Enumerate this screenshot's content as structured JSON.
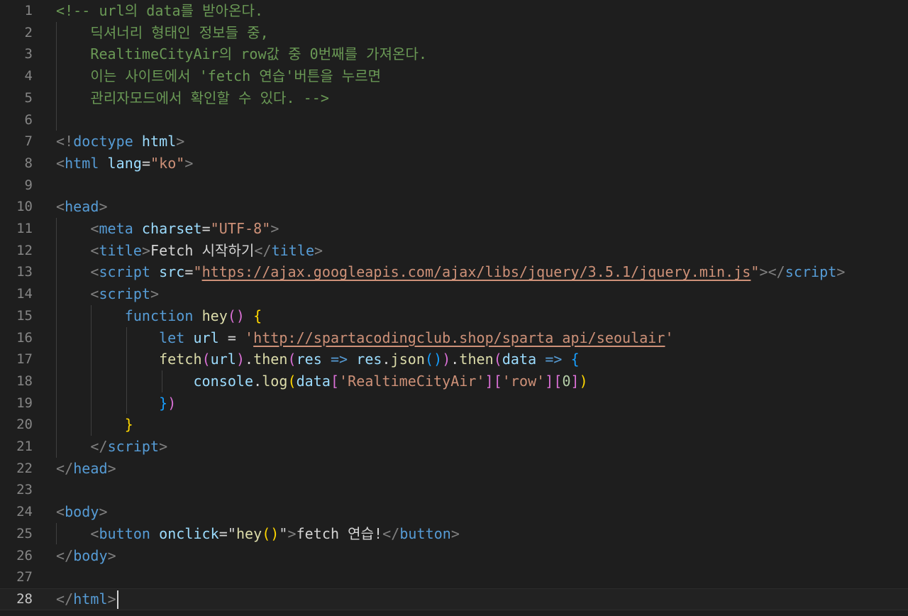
{
  "editor": {
    "language": "html",
    "current_line": 28,
    "colors": {
      "background": "#1e1e1e",
      "comment": "#6a9955",
      "tag": "#569cd6",
      "attribute": "#9cdcfe",
      "string": "#ce9178",
      "function": "#dcdcaa",
      "bracket_level1": "#ffd700",
      "bracket_level2": "#da70d6",
      "bracket_level3": "#179fff"
    },
    "lines": [
      {
        "n": "1",
        "tokens": [
          {
            "t": "<!-- url의 data를 받아온다.",
            "c": "cmt"
          }
        ]
      },
      {
        "n": "2",
        "tokens": [
          {
            "t": "    딕셔너리 형태인 정보들 중,",
            "c": "cmt"
          }
        ]
      },
      {
        "n": "3",
        "tokens": [
          {
            "t": "    RealtimeCityAir의 row값 중 0번째를 가져온다.",
            "c": "cmt"
          }
        ]
      },
      {
        "n": "4",
        "tokens": [
          {
            "t": "    이는 사이트에서 'fetch 연습'버튼을 누르면",
            "c": "cmt"
          }
        ]
      },
      {
        "n": "5",
        "tokens": [
          {
            "t": "    관리자모드에서 확인할 수 있다. -->",
            "c": "cmt"
          }
        ]
      },
      {
        "n": "6",
        "tokens": []
      },
      {
        "n": "7",
        "tokens": [
          {
            "t": "<!",
            "c": "pun"
          },
          {
            "t": "doctype",
            "c": "tag"
          },
          {
            "t": " html",
            "c": "attr"
          },
          {
            "t": ">",
            "c": "pun"
          }
        ]
      },
      {
        "n": "8",
        "tokens": [
          {
            "t": "<",
            "c": "pun"
          },
          {
            "t": "html",
            "c": "tag"
          },
          {
            "t": " lang",
            "c": "attr"
          },
          {
            "t": "=",
            "c": "op"
          },
          {
            "t": "\"ko\"",
            "c": "str"
          },
          {
            "t": ">",
            "c": "pun"
          }
        ]
      },
      {
        "n": "9",
        "tokens": []
      },
      {
        "n": "10",
        "tokens": [
          {
            "t": "<",
            "c": "pun"
          },
          {
            "t": "head",
            "c": "tag"
          },
          {
            "t": ">",
            "c": "pun"
          }
        ]
      },
      {
        "n": "11",
        "tokens": [
          {
            "t": "    ",
            "c": "txt"
          },
          {
            "t": "<",
            "c": "pun"
          },
          {
            "t": "meta",
            "c": "tag"
          },
          {
            "t": " charset",
            "c": "attr"
          },
          {
            "t": "=",
            "c": "op"
          },
          {
            "t": "\"UTF-8\"",
            "c": "str"
          },
          {
            "t": ">",
            "c": "pun"
          }
        ]
      },
      {
        "n": "12",
        "tokens": [
          {
            "t": "    ",
            "c": "txt"
          },
          {
            "t": "<",
            "c": "pun"
          },
          {
            "t": "title",
            "c": "tag"
          },
          {
            "t": ">",
            "c": "pun"
          },
          {
            "t": "Fetch 시작하기",
            "c": "txt"
          },
          {
            "t": "</",
            "c": "pun"
          },
          {
            "t": "title",
            "c": "tag"
          },
          {
            "t": ">",
            "c": "pun"
          }
        ]
      },
      {
        "n": "13",
        "tokens": [
          {
            "t": "    ",
            "c": "txt"
          },
          {
            "t": "<",
            "c": "pun"
          },
          {
            "t": "script",
            "c": "tag"
          },
          {
            "t": " src",
            "c": "attr"
          },
          {
            "t": "=",
            "c": "op"
          },
          {
            "t": "\"",
            "c": "str"
          },
          {
            "t": "https://ajax.googleapis.com/ajax/libs/jquery/3.5.1/jquery.min.js",
            "c": "str ul"
          },
          {
            "t": "\"",
            "c": "str"
          },
          {
            "t": "></",
            "c": "pun"
          },
          {
            "t": "script",
            "c": "tag"
          },
          {
            "t": ">",
            "c": "pun"
          }
        ]
      },
      {
        "n": "14",
        "tokens": [
          {
            "t": "    ",
            "c": "txt"
          },
          {
            "t": "<",
            "c": "pun"
          },
          {
            "t": "script",
            "c": "tag"
          },
          {
            "t": ">",
            "c": "pun"
          }
        ]
      },
      {
        "n": "15",
        "tokens": [
          {
            "t": "        ",
            "c": "txt"
          },
          {
            "t": "function",
            "c": "kw"
          },
          {
            "t": " ",
            "c": "txt"
          },
          {
            "t": "hey",
            "c": "fn"
          },
          {
            "t": "()",
            "c": "b2"
          },
          {
            "t": " ",
            "c": "txt"
          },
          {
            "t": "{",
            "c": "b1"
          }
        ]
      },
      {
        "n": "16",
        "tokens": [
          {
            "t": "            ",
            "c": "txt"
          },
          {
            "t": "let",
            "c": "kw"
          },
          {
            "t": " ",
            "c": "txt"
          },
          {
            "t": "url",
            "c": "var"
          },
          {
            "t": " = ",
            "c": "op"
          },
          {
            "t": "'",
            "c": "str"
          },
          {
            "t": "http://spartacodingclub.shop/sparta_api/seoulair",
            "c": "str ul"
          },
          {
            "t": "'",
            "c": "str"
          }
        ]
      },
      {
        "n": "17",
        "tokens": [
          {
            "t": "            ",
            "c": "txt"
          },
          {
            "t": "fetch",
            "c": "fn"
          },
          {
            "t": "(",
            "c": "b2"
          },
          {
            "t": "url",
            "c": "var"
          },
          {
            "t": ")",
            "c": "b2"
          },
          {
            "t": ".",
            "c": "op"
          },
          {
            "t": "then",
            "c": "fn"
          },
          {
            "t": "(",
            "c": "b2"
          },
          {
            "t": "res",
            "c": "var"
          },
          {
            "t": " ",
            "c": "txt"
          },
          {
            "t": "=>",
            "c": "kw"
          },
          {
            "t": " ",
            "c": "txt"
          },
          {
            "t": "res",
            "c": "var"
          },
          {
            "t": ".",
            "c": "op"
          },
          {
            "t": "json",
            "c": "fn"
          },
          {
            "t": "()",
            "c": "b3"
          },
          {
            "t": ")",
            "c": "b2"
          },
          {
            "t": ".",
            "c": "op"
          },
          {
            "t": "then",
            "c": "fn"
          },
          {
            "t": "(",
            "c": "b2"
          },
          {
            "t": "data",
            "c": "var"
          },
          {
            "t": " ",
            "c": "txt"
          },
          {
            "t": "=>",
            "c": "kw"
          },
          {
            "t": " ",
            "c": "txt"
          },
          {
            "t": "{",
            "c": "b3"
          }
        ]
      },
      {
        "n": "18",
        "tokens": [
          {
            "t": "                ",
            "c": "txt"
          },
          {
            "t": "console",
            "c": "var"
          },
          {
            "t": ".",
            "c": "op"
          },
          {
            "t": "log",
            "c": "fn"
          },
          {
            "t": "(",
            "c": "b1"
          },
          {
            "t": "data",
            "c": "var"
          },
          {
            "t": "[",
            "c": "b2"
          },
          {
            "t": "'RealtimeCityAir'",
            "c": "str"
          },
          {
            "t": "]",
            "c": "b2"
          },
          {
            "t": "[",
            "c": "b2"
          },
          {
            "t": "'row'",
            "c": "str"
          },
          {
            "t": "]",
            "c": "b2"
          },
          {
            "t": "[",
            "c": "b2"
          },
          {
            "t": "0",
            "c": "num"
          },
          {
            "t": "]",
            "c": "b2"
          },
          {
            "t": ")",
            "c": "b1"
          }
        ]
      },
      {
        "n": "19",
        "tokens": [
          {
            "t": "            ",
            "c": "txt"
          },
          {
            "t": "}",
            "c": "b3"
          },
          {
            "t": ")",
            "c": "b2"
          }
        ]
      },
      {
        "n": "20",
        "tokens": [
          {
            "t": "        ",
            "c": "txt"
          },
          {
            "t": "}",
            "c": "b1"
          }
        ]
      },
      {
        "n": "21",
        "tokens": [
          {
            "t": "    ",
            "c": "txt"
          },
          {
            "t": "</",
            "c": "pun"
          },
          {
            "t": "script",
            "c": "tag"
          },
          {
            "t": ">",
            "c": "pun"
          }
        ]
      },
      {
        "n": "22",
        "tokens": [
          {
            "t": "</",
            "c": "pun"
          },
          {
            "t": "head",
            "c": "tag"
          },
          {
            "t": ">",
            "c": "pun"
          }
        ]
      },
      {
        "n": "23",
        "tokens": []
      },
      {
        "n": "24",
        "tokens": [
          {
            "t": "<",
            "c": "pun"
          },
          {
            "t": "body",
            "c": "tag"
          },
          {
            "t": ">",
            "c": "pun"
          }
        ]
      },
      {
        "n": "25",
        "tokens": [
          {
            "t": "    ",
            "c": "txt"
          },
          {
            "t": "<",
            "c": "pun"
          },
          {
            "t": "button",
            "c": "tag"
          },
          {
            "t": " onclick",
            "c": "attr"
          },
          {
            "t": "=",
            "c": "op"
          },
          {
            "t": "\"",
            "c": "txt"
          },
          {
            "t": "hey",
            "c": "fn"
          },
          {
            "t": "()",
            "c": "b1"
          },
          {
            "t": "\"",
            "c": "txt"
          },
          {
            "t": ">",
            "c": "pun"
          },
          {
            "t": "fetch 연습!",
            "c": "txt"
          },
          {
            "t": "</",
            "c": "pun"
          },
          {
            "t": "button",
            "c": "tag"
          },
          {
            "t": ">",
            "c": "pun"
          }
        ]
      },
      {
        "n": "26",
        "tokens": [
          {
            "t": "</",
            "c": "pun"
          },
          {
            "t": "body",
            "c": "tag"
          },
          {
            "t": ">",
            "c": "pun"
          }
        ]
      },
      {
        "n": "27",
        "tokens": []
      },
      {
        "n": "28",
        "tokens": [
          {
            "t": "</",
            "c": "pun"
          },
          {
            "t": "html",
            "c": "tag"
          },
          {
            "t": ">",
            "c": "pun"
          }
        ]
      }
    ]
  }
}
